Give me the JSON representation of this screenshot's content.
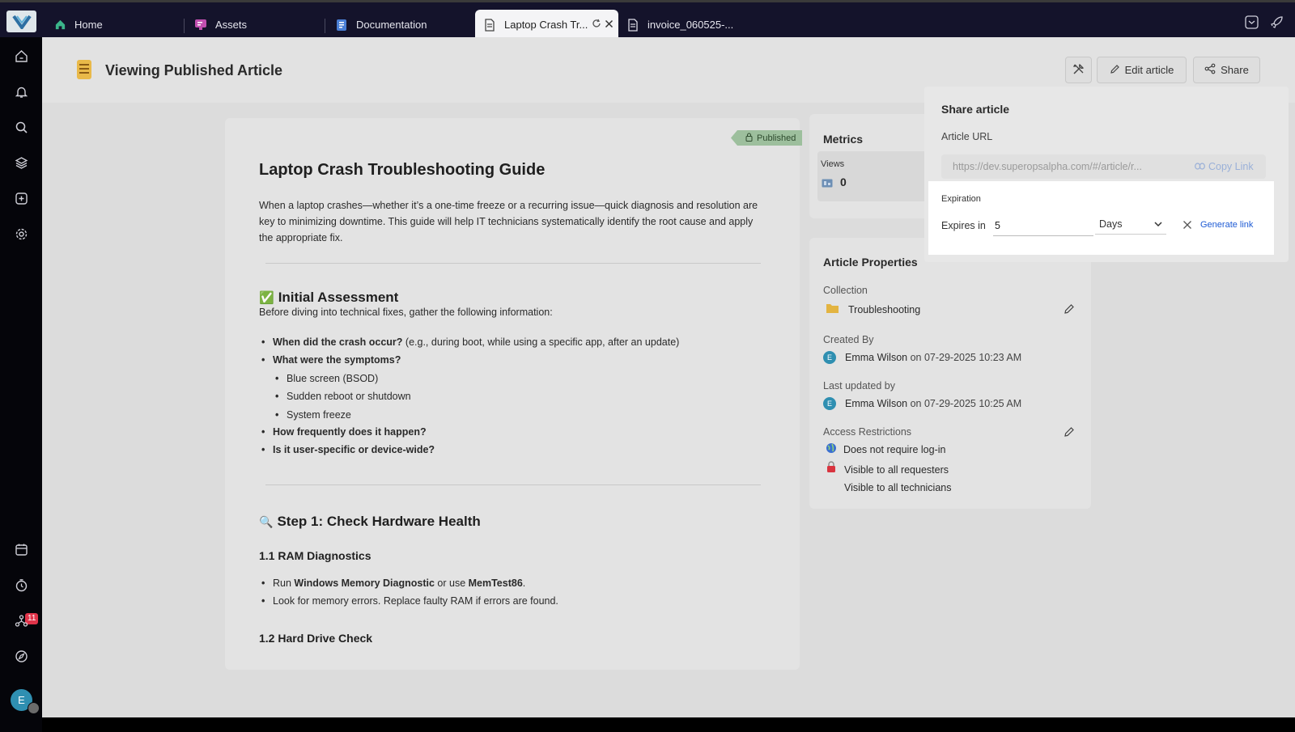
{
  "tabs": [
    {
      "label": "Home",
      "icon": "home-icon",
      "color": "#3bb58a"
    },
    {
      "label": "Assets",
      "icon": "monitor-icon",
      "color": "#c14fb0"
    },
    {
      "label": "Documentation",
      "icon": "book-icon",
      "color": "#4a7fd6"
    },
    {
      "label": "Laptop Crash Tr...",
      "icon": "document-icon",
      "active": true
    },
    {
      "label": "invoice_060525-...",
      "icon": "document-icon"
    }
  ],
  "sidebar": {
    "top_items": [
      "home-icon",
      "bell-icon",
      "search-icon",
      "layers-icon",
      "plus-square-icon",
      "gear-icon"
    ],
    "bottom_items": [
      "calendar-icon",
      "timer-icon",
      "network-icon",
      "compass-icon"
    ],
    "timer_badge": "11",
    "avatar_initial": "E"
  },
  "header": {
    "title": "Viewing Published Article",
    "edit_label": "Edit article",
    "share_label": "Share"
  },
  "article": {
    "status": "Published",
    "title": "Laptop Crash Troubleshooting Guide",
    "intro": "When a laptop crashes—whether it’s a one-time freeze or a recurring issue—quick diagnosis and resolution are key to minimizing downtime. This guide will help IT technicians systematically identify the root cause and apply the appropriate fix.",
    "section1": {
      "emoji": "✅",
      "heading": "Initial Assessment",
      "lead": "Before diving into technical fixes, gather the following information:",
      "q1_bold": "When did the crash occur?",
      "q1_rest": " (e.g., during boot, while using a specific app, after an update)",
      "q2_bold": "What were the symptoms?",
      "symptoms": [
        "Blue screen (BSOD)",
        "Sudden reboot or shutdown",
        "System freeze"
      ],
      "q3_bold": "How frequently does it happen?",
      "q4_bold": "Is it user-specific or device-wide?"
    },
    "section2": {
      "emoji": "🔍",
      "heading": "Step 1: Check Hardware Health",
      "sub1": "1.1 RAM Diagnostics",
      "b1_pre": "Run ",
      "b1_bold1": "Windows Memory Diagnostic",
      "b1_mid": " or use ",
      "b1_bold2": "MemTest86",
      "b1_end": ".",
      "b2": "Look for memory errors. Replace faulty RAM if errors are found.",
      "sub2": "1.2 Hard Drive Check"
    }
  },
  "metrics": {
    "title": "Metrics",
    "views_label": "Views",
    "views_value": "0"
  },
  "properties": {
    "title": "Article Properties",
    "collection_label": "Collection",
    "collection_value": "Troubleshooting",
    "created_label": "Created By",
    "created_name": "Emma Wilson",
    "created_on": " on 07-29-2025 10:23 AM",
    "updated_label": "Last updated by",
    "updated_name": "Emma Wilson",
    "updated_on": " on 07-29-2025 10:25 AM",
    "access_label": "Access Restrictions",
    "access_login": "Does not require log-in",
    "access_requesters": "Visible to all requesters",
    "access_technicians": "Visible to all technicians",
    "user_initial": "E"
  },
  "share": {
    "title": "Share article",
    "url_label": "Article URL",
    "url_value": "https://dev.superopsalpha.com/#/article/r...",
    "copy_label": "Copy Link",
    "expiration_title": "Expiration",
    "expires_label": "Expires in",
    "expires_value": "5",
    "unit_value": "Days",
    "generate_label": "Generate link"
  },
  "colors": {
    "topbar": "#14132b",
    "sidebar": "#05050a",
    "accent_link": "#1e5bd4",
    "published_badge": "#9dbf9d",
    "badge_red": "#e0344a"
  }
}
